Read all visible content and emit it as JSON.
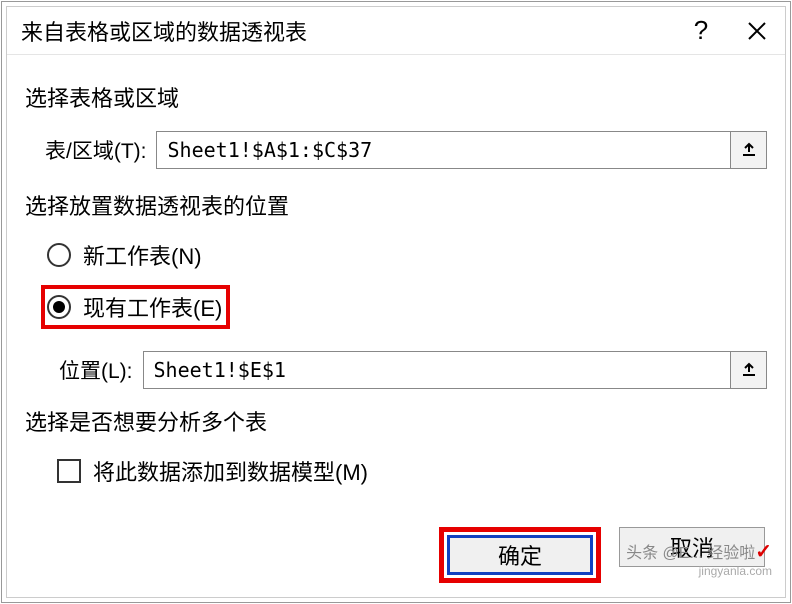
{
  "titlebar": {
    "title": "来自表格或区域的数据透视表",
    "help": "?",
    "close": "×"
  },
  "section1": {
    "label": "选择表格或区域",
    "field_label": "表/区域(T):",
    "field_value": "Sheet1!$A$1:$C$37"
  },
  "section2": {
    "label": "选择放置数据透视表的位置",
    "radio_new": "新工作表(N)",
    "radio_existing": "现有工作表(E)",
    "location_label": "位置(L):",
    "location_value": "Sheet1!$E$1"
  },
  "section3": {
    "label": "选择是否想要分析多个表",
    "checkbox_label": "将此数据添加到数据模型(M)"
  },
  "buttons": {
    "ok": "确定",
    "cancel": "取消"
  },
  "watermark": {
    "line1": "头条 @E... 经验啦",
    "line2": "jingyanla.com"
  }
}
